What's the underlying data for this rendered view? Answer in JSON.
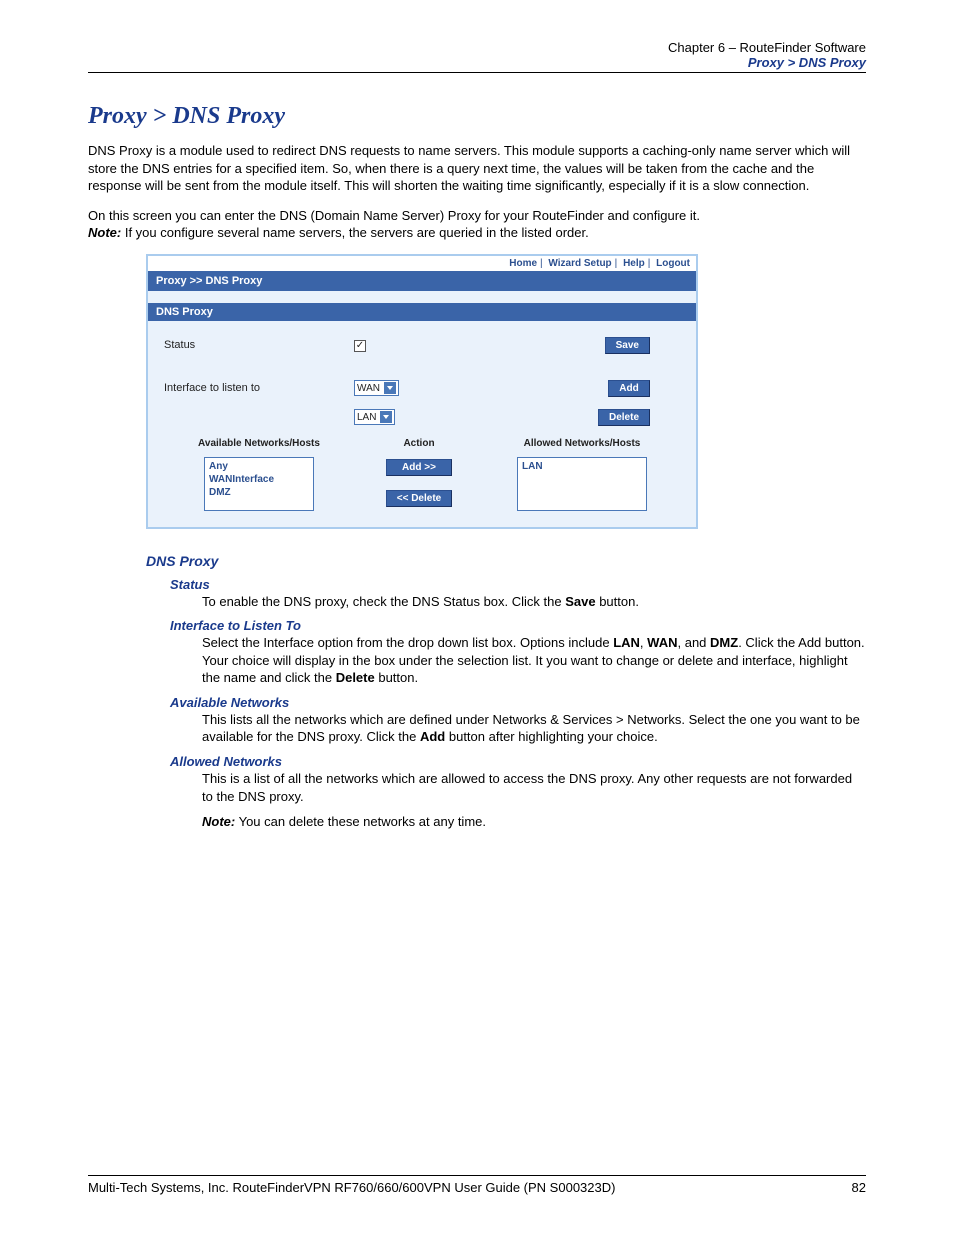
{
  "header": {
    "chapter": "Chapter 6 – RouteFinder Software",
    "path": "Proxy > DNS Proxy"
  },
  "title": "Proxy > DNS Proxy",
  "para1": "DNS Proxy is a module used to redirect DNS requests to name servers. This module supports a caching-only name server which will store the DNS entries for a specified item. So, when there is a query next time, the values will be taken from the cache and the response will be sent from the module itself. This will shorten the waiting time significantly, especially if it is a slow connection.",
  "para2_a": "On this screen you can enter the DNS (Domain Name Server) Proxy for your RouteFinder and configure it.",
  "note_label": "Note:",
  "para2_b": "If you configure several name servers, the servers are queried in the listed order.",
  "screenshot": {
    "toplinks": [
      "Home",
      "Wizard Setup",
      "Help",
      "Logout"
    ],
    "breadcrumb": "Proxy >> DNS Proxy",
    "section": "DNS Proxy",
    "status_label": "Status",
    "status_checked": "✓",
    "save_btn": "Save",
    "iface_label": "Interface to listen to",
    "iface_select1": "WAN",
    "iface_select2": "LAN",
    "add_btn": "Add",
    "delete_btn": "Delete",
    "avail_head": "Available Networks/Hosts",
    "action_head": "Action",
    "allowed_head": "Allowed Networks/Hosts",
    "avail_items": [
      "Any",
      "WANInterface",
      "DMZ"
    ],
    "allowed_items": [
      "LAN"
    ],
    "add_arrow_btn": "Add  >>",
    "del_arrow_btn": "<< Delete"
  },
  "defs": {
    "heading": "DNS Proxy",
    "status": {
      "h": "Status",
      "b_a": "To enable the DNS proxy, check the DNS Status box. Click the ",
      "b_bold": "Save",
      "b_c": " button."
    },
    "iface": {
      "h": "Interface to Listen To",
      "b_a": "Select the Interface option from the drop down list box. Options include ",
      "lan": "LAN",
      "wan": "WAN",
      "dmz": "DMZ",
      "b_b": ". Click the Add button. Your choice will display in the box under the selection list. It you want to change or delete and interface, highlight the name and click the ",
      "del": "Delete",
      "b_c": " button."
    },
    "avail": {
      "h": "Available Networks",
      "b_a": "This lists all the networks which are defined under Networks & Services > Networks. Select the one you want to be available for the DNS proxy. Click the ",
      "add": "Add",
      "b_b": " button after highlighting your choice."
    },
    "allowed": {
      "h": "Allowed Networks",
      "b1": "This is a list of all the networks which are allowed to access the DNS proxy. Any other requests are not forwarded to the DNS proxy.",
      "note": "Note:",
      "b2": " You can delete these networks at any time."
    }
  },
  "footer": {
    "left": "Multi-Tech Systems, Inc. RouteFinderVPN RF760/660/600VPN User Guide (PN S000323D)",
    "right": "82"
  }
}
